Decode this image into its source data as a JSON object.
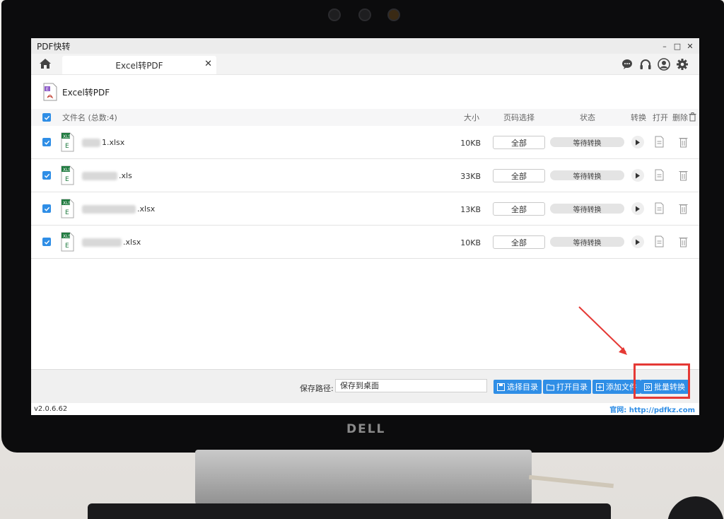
{
  "app": {
    "title": "PDF快转"
  },
  "window_controls": {
    "minimize": "–",
    "maximize": "□",
    "close": "✕"
  },
  "tab": {
    "label": "Excel转PDF",
    "close": "✕"
  },
  "section": {
    "title": "Excel转PDF"
  },
  "list": {
    "header": {
      "filename": "文件名 (总数:4)",
      "size": "大小",
      "page_select": "页码选择",
      "status": "状态",
      "convert": "转换",
      "open": "打开",
      "delete": "删除"
    },
    "rows": [
      {
        "name": "1.xlsx",
        "size": "10KB",
        "pages": "全部",
        "status": "等待转换"
      },
      {
        "name": ".xls",
        "size": "33KB",
        "pages": "全部",
        "status": "等待转换"
      },
      {
        "name": ".xlsx",
        "size": "13KB",
        "pages": "全部",
        "status": "等待转换"
      },
      {
        "name": ".xlsx",
        "size": "10KB",
        "pages": "全部",
        "status": "等待转换"
      }
    ]
  },
  "footer": {
    "save_label": "保存路径:",
    "save_value": "保存到桌面",
    "btn_select_dir": "选择目录",
    "btn_open_dir": "打开目录",
    "btn_add_file": "添加文件",
    "btn_batch_convert": "批量转换"
  },
  "statusbar": {
    "version": "v2.0.6.62",
    "site": "官网: http://pdfkz.com"
  },
  "brand": {
    "monitor": "DELL"
  },
  "colors": {
    "accent": "#2f8ee6",
    "highlight": "#e53935",
    "excel_green": "#1f7a3f",
    "pdf_purple": "#8e5cc9"
  }
}
